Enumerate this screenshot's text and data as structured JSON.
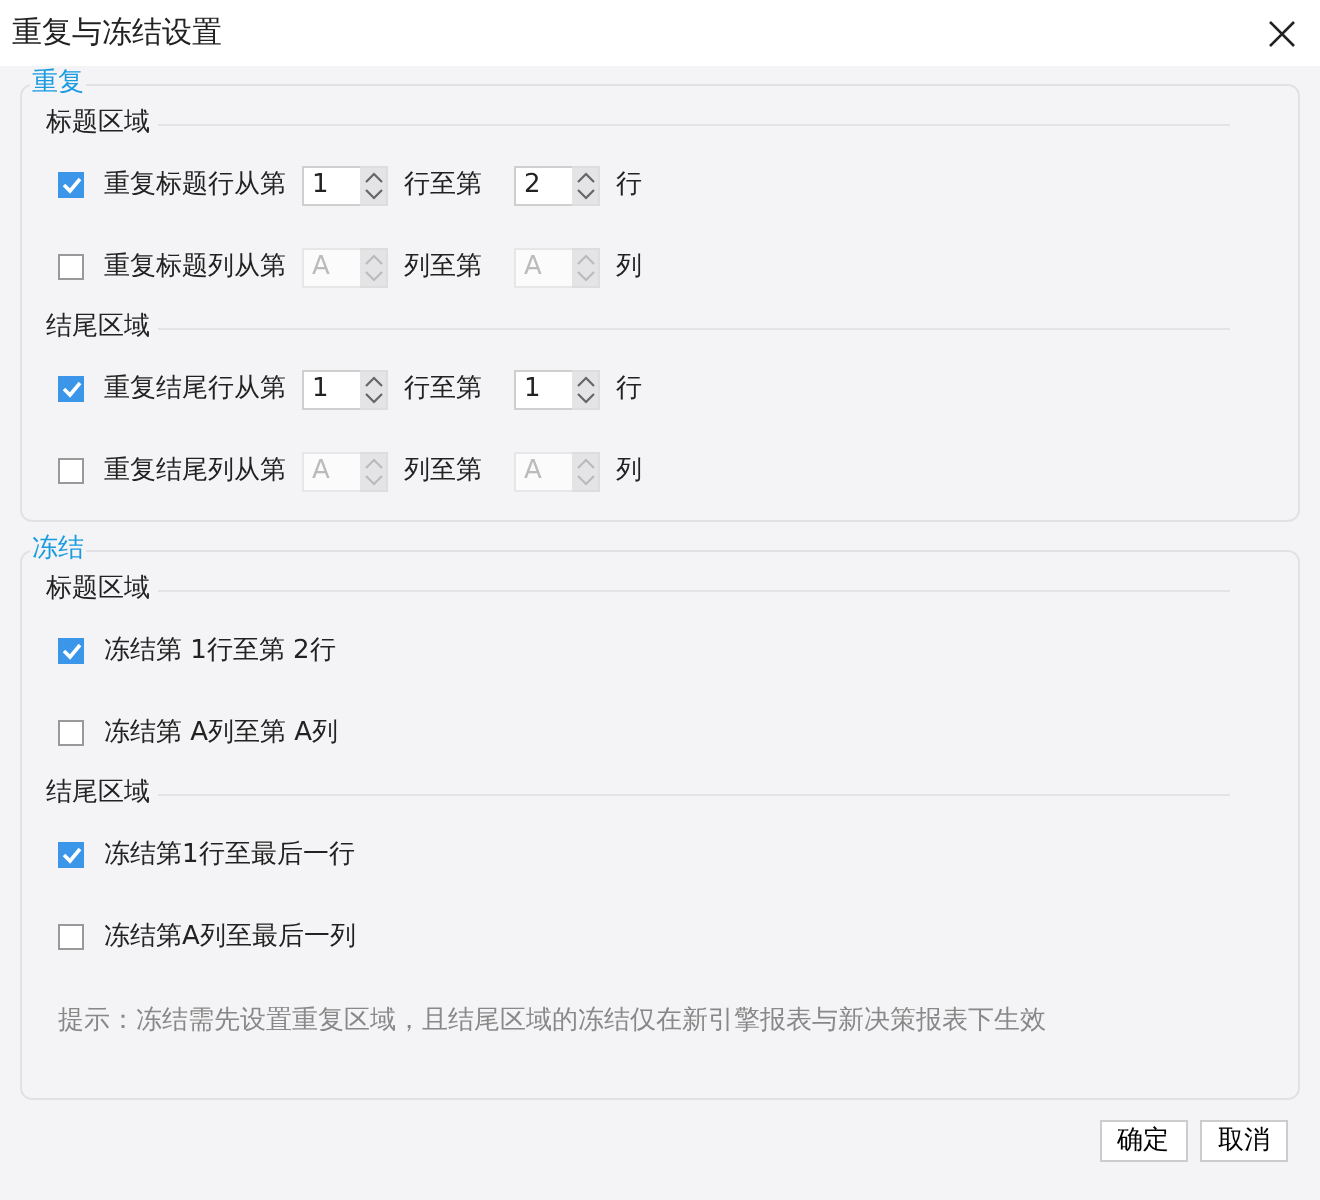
{
  "window": {
    "title": "重复与冻结设置"
  },
  "sections": [
    {
      "legend": "重复",
      "groups": [
        {
          "title": "标题区域",
          "rows": [
            {
              "kind": "range",
              "checked": true,
              "label": "重复标题行从第",
              "from": {
                "value": "1",
                "disabled": false
              },
              "middle": "行至第",
              "to": {
                "value": "2",
                "disabled": false
              },
              "unit": "行"
            },
            {
              "kind": "range",
              "checked": false,
              "label": "重复标题列从第",
              "from": {
                "placeholder": "A",
                "disabled": true
              },
              "middle": "列至第",
              "to": {
                "placeholder": "A",
                "disabled": true
              },
              "unit": "列"
            }
          ]
        },
        {
          "title": "结尾区域",
          "rows": [
            {
              "kind": "range",
              "checked": true,
              "label": "重复结尾行从第",
              "from": {
                "value": "1",
                "disabled": false
              },
              "middle": "行至第",
              "to": {
                "value": "1",
                "disabled": false
              },
              "unit": "行"
            },
            {
              "kind": "range",
              "checked": false,
              "label": "重复结尾列从第",
              "from": {
                "placeholder": "A",
                "disabled": true
              },
              "middle": "列至第",
              "to": {
                "placeholder": "A",
                "disabled": true
              },
              "unit": "列"
            }
          ]
        }
      ]
    },
    {
      "legend": "冻结",
      "groups": [
        {
          "title": "标题区域",
          "rows": [
            {
              "kind": "text",
              "checked": true,
              "label": "冻结第 1行至第 2行"
            },
            {
              "kind": "text",
              "checked": false,
              "label": "冻结第 A列至第 A列"
            }
          ]
        },
        {
          "title": "结尾区域",
          "rows": [
            {
              "kind": "text",
              "checked": true,
              "label": "冻结第1行至最后一行"
            },
            {
              "kind": "text",
              "checked": false,
              "label": "冻结第A列至最后一列"
            }
          ]
        }
      ],
      "hint": "提示：冻结需先设置重复区域，且结尾区域的冻结仅在新引擎报表与新决策报表下生效"
    }
  ],
  "buttons": [
    "确定",
    "取消"
  ]
}
